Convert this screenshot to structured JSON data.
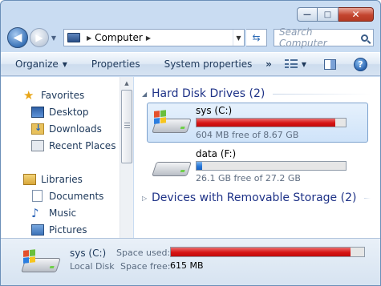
{
  "window": {
    "minimize_glyph": "—",
    "maximize_glyph": "□",
    "close_glyph": "✕"
  },
  "address_bar": {
    "location": "Computer",
    "search_placeholder": "Search Computer"
  },
  "toolbar": {
    "organize": "Organize",
    "properties": "Properties",
    "system_properties": "System properties",
    "more": "»"
  },
  "nav_pane": {
    "favorites_label": "Favorites",
    "favorites": [
      {
        "label": "Desktop",
        "icon": "desktop-icon"
      },
      {
        "label": "Downloads",
        "icon": "downloads-icon"
      },
      {
        "label": "Recent Places",
        "icon": "recent-places-icon"
      }
    ],
    "libraries_label": "Libraries",
    "libraries": [
      {
        "label": "Documents",
        "icon": "documents-icon"
      },
      {
        "label": "Music",
        "icon": "music-icon"
      },
      {
        "label": "Pictures",
        "icon": "pictures-icon"
      }
    ]
  },
  "content": {
    "hard_disk_header": "Hard Disk Drives (2)",
    "drives": [
      {
        "name": "sys (C:)",
        "free_text": "604 MB free of 8.67 GB",
        "used_fraction": 0.93,
        "bar_color": "#d71414",
        "selected": true
      },
      {
        "name": "data (F:)",
        "free_text": "26.1 GB free of 27.2 GB",
        "used_fraction": 0.04,
        "bar_color": "#2676d8",
        "selected": false
      }
    ],
    "removable_header": "Devices with Removable Storage (2)"
  },
  "details": {
    "name": "sys (C:)",
    "type": "Local Disk",
    "space_used_label": "Space used:",
    "space_free_label": "Space free:",
    "space_free_value": "615 MB",
    "used_fraction": 0.93
  }
}
